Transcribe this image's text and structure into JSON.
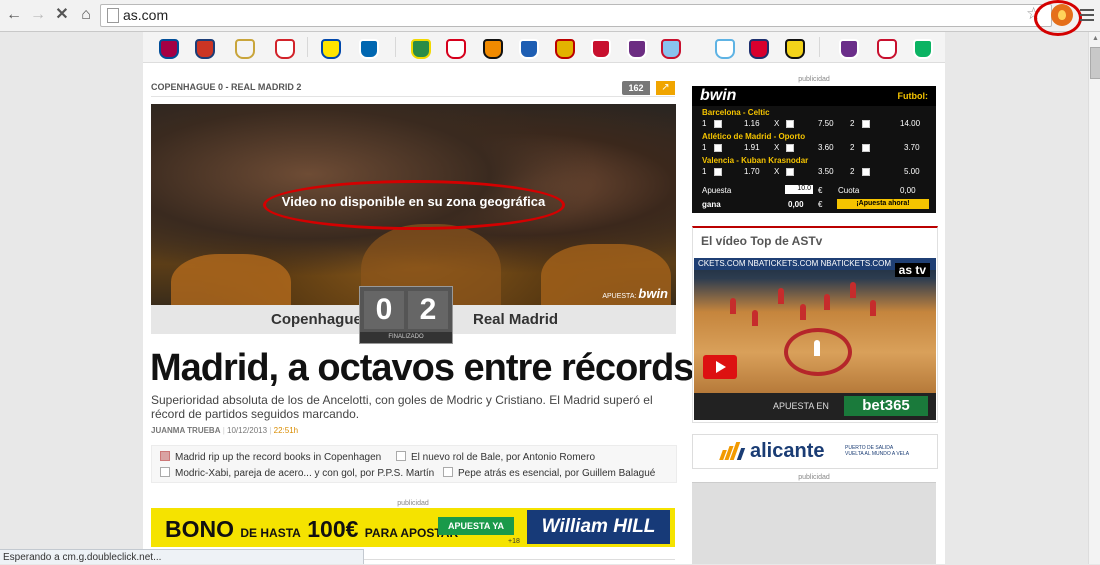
{
  "browser": {
    "url": "as.com",
    "status_text": "Esperando a cm.g.doubleclick.net..."
  },
  "icons": {
    "back": "arrow-left",
    "forward": "arrow-right",
    "stop": "x",
    "home": "house",
    "bookmark": "star",
    "extension": "flame",
    "menu": "hamburger"
  },
  "article": {
    "kicker": "COPENHAGUE 0 - REAL MADRID 2",
    "comment_count": "162",
    "video_message": "Video no disponible en su zona geográfica",
    "video_sponsor_label": "APUESTA:",
    "video_sponsor_brand": "bwin",
    "home_team": "Copenhague",
    "away_team": "Real Madrid",
    "home_score": "0",
    "away_score": "2",
    "match_state": "FINALIZADO",
    "headline": "Madrid, a octavos entre récords",
    "deck": "Superioridad absoluta de los de Ancelotti, con goles de Modric y Cristiano. El Madrid superó el récord de partidos seguidos marcando.",
    "author": "JUANMA TRUEBA",
    "date": "10/12/2013",
    "time": "22:51h",
    "related": [
      "Madrid rip up the record books in Copenhagen",
      "El nuevo rol de Bale, por Antonio Romero",
      "Modric-Xabi, pareja de acero... y con gol, por P.P.S. Martín",
      "Pepe atrás es esencial, por Guillem Balagué"
    ]
  },
  "ads": {
    "label": "publicidad",
    "bono_prefix": "BONO",
    "bono_middle": "DE HASTA",
    "bono_amount": "100€",
    "bono_suffix": "PARA APOSTAR",
    "bono_cta": "APUESTA YA",
    "bono_age": "+18",
    "bono_brand": "William HILL"
  },
  "bwin_widget": {
    "brand": "bwin",
    "category": "Futbol:",
    "matches": [
      {
        "name": "Barcelona - Celtic",
        "odd1": "1.16",
        "oddx": "7.50",
        "odd2": "14.00"
      },
      {
        "name": "Atlético de Madrid - Oporto",
        "odd1": "1.91",
        "oddx": "3.60",
        "odd2": "3.70"
      },
      {
        "name": "Valencia - Kuban Krasnodar",
        "odd1": "1.70",
        "oddx": "3.50",
        "odd2": "5.00"
      }
    ],
    "label_1": "1",
    "label_x": "X",
    "label_2": "2",
    "stake_label": "Apuesta",
    "stake_value": "10.0",
    "currency": "€",
    "quota_label": "Cuota",
    "quota_value": "0,00",
    "win_label": "gana",
    "win_value": "0,00",
    "cta": "¡Apuesta ahora!"
  },
  "astv": {
    "title": "El vídeo Top de ASTv",
    "logo": "as tv",
    "court_text": "CKETS.COM  NBATICKETS.COM  NBATICKETS.COM",
    "bet_label": "APUESTA EN",
    "bet_brand": "bet365"
  },
  "alicante": {
    "name": "alicante",
    "sub_line1": "PUERTO DE SALIDA",
    "sub_line2": "VUELTA AL MUNDO A VELA"
  },
  "colors": {
    "accent_orange": "#f0a500",
    "bwin_yellow": "#f5c400",
    "as_red": "#b00000",
    "annotation_red": "#d40000"
  }
}
